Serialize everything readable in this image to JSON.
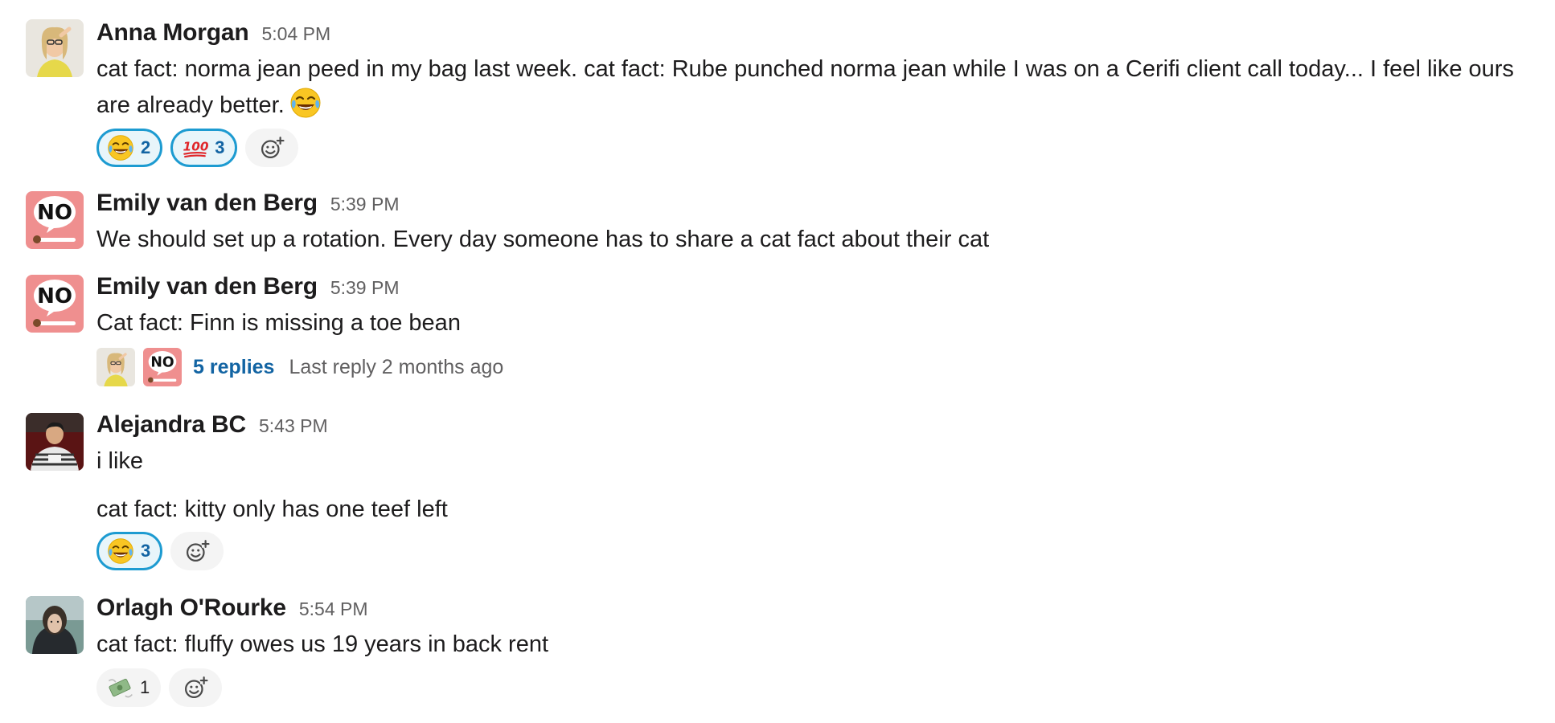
{
  "colors": {
    "link": "#1264a3",
    "reaction_border": "#1d9bd1",
    "reaction_bg": "#e8f5fa",
    "muted": "#616061",
    "no_avatar_bg": "#ef8f8f"
  },
  "messages": [
    {
      "author": "Anna Morgan",
      "time": "5:04 PM",
      "text": "cat fact: norma jean peed in my bag last week. cat fact: Rube punched norma jean while I was on a Cerifi client call today... I feel like ours are already better.",
      "inline_emoji": "joy-emoji",
      "reactions": [
        {
          "emoji": "joy-emoji",
          "count": "2"
        },
        {
          "emoji": "hundred-emoji",
          "count": "3"
        }
      ]
    },
    {
      "author": "Emily van den Berg",
      "time": "5:39 PM",
      "text": "We should set up a rotation. Every day someone has to share a cat fact about their cat",
      "avatar_text": "NO"
    },
    {
      "author": "Emily van den Berg",
      "time": "5:39 PM",
      "text": "Cat fact: Finn is missing a toe bean",
      "avatar_text": "NO",
      "thread": {
        "replies": "5 replies",
        "last_reply": "Last reply 2 months ago"
      }
    },
    {
      "author": "Alejandra BC",
      "time": "5:43 PM",
      "text": "i like",
      "followup": "cat fact: kitty only has one teef left",
      "reactions": [
        {
          "emoji": "joy-emoji",
          "count": "3"
        }
      ]
    },
    {
      "author": "Orlagh O'Rourke",
      "time": "5:54 PM",
      "text": "cat fact: fluffy owes us 19 years in back rent",
      "reactions": [
        {
          "emoji": "money-with-wings-emoji",
          "count": "1"
        }
      ]
    }
  ]
}
